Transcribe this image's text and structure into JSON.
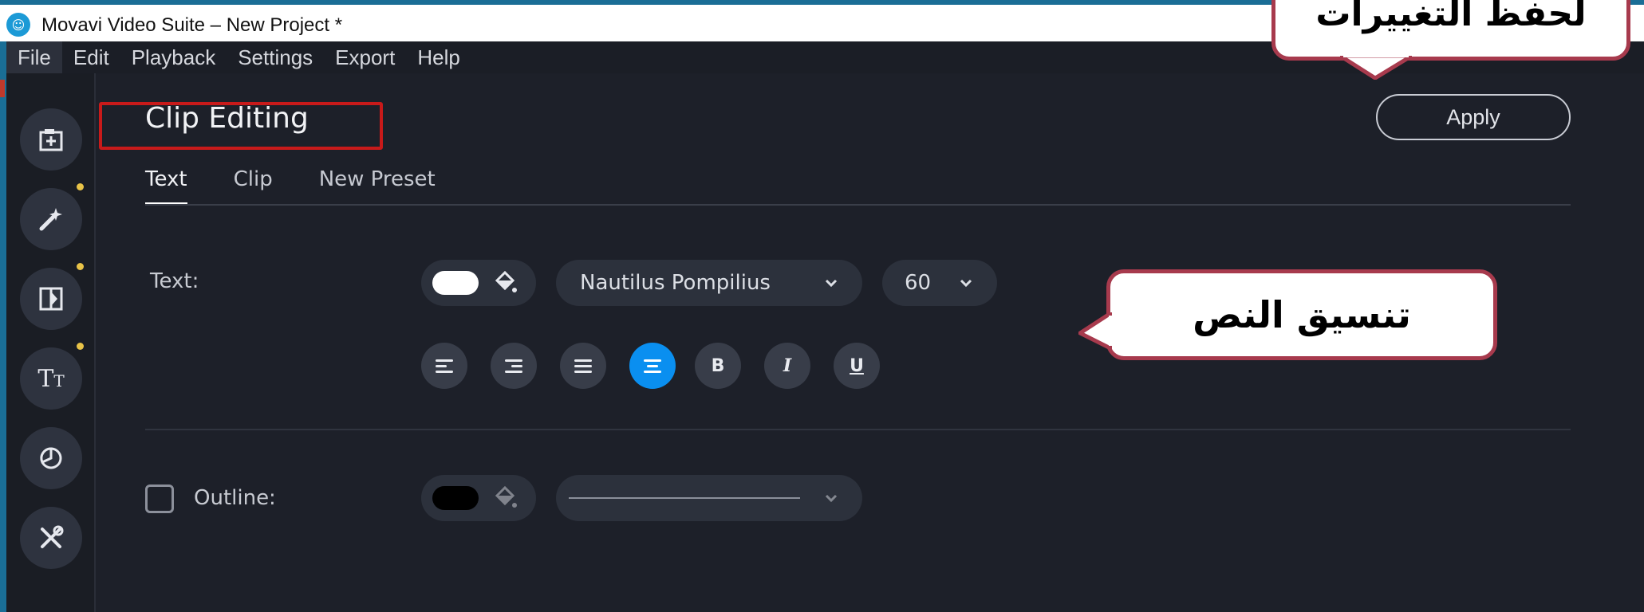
{
  "window": {
    "title": "Movavi Video Suite – New Project *",
    "app_icon_glyph": "☺"
  },
  "menu": [
    "File",
    "Edit",
    "Playback",
    "Settings",
    "Export",
    "Help"
  ],
  "panel": {
    "title": "Clip Editing",
    "apply_label": "Apply",
    "tabs": [
      "Text",
      "Clip",
      "New Preset"
    ],
    "active_tab": "Text"
  },
  "text_row": {
    "label": "Text:",
    "color": "#ffffff",
    "font_name": "Nautilus Pompilius",
    "font_size": "60",
    "format_buttons": [
      "align-left",
      "align-right",
      "justify",
      "align-center",
      "B",
      "I",
      "U"
    ],
    "active_format": "align-center"
  },
  "outline_row": {
    "label": "Outline:",
    "checked": false,
    "color": "#000000"
  },
  "callouts": {
    "save_changes": "لحفظ التغييرات",
    "text_formatting": "تنسيق النص"
  },
  "colors": {
    "accent": "#0a8ff0",
    "background": "#1d2029",
    "callout_border": "#a73a4d",
    "highlight_box": "#c81a1a",
    "notification_dot": "#e8c348"
  },
  "rail_icons": [
    "add-media-icon",
    "magic-wand-icon",
    "transitions-icon",
    "titles-icon",
    "stickers-icon",
    "tools-icon"
  ]
}
